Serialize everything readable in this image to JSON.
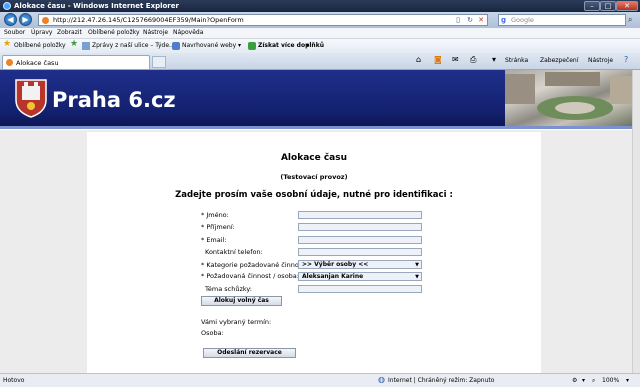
{
  "window": {
    "title": "Alokace času - Windows Internet Explorer",
    "minimize": "–",
    "maximize": "□",
    "close": "✕"
  },
  "address": {
    "url": "http://212.47.26.145/C1257669004EF359/Main?OpenForm",
    "search_placeholder": "Google"
  },
  "menu": [
    "Soubor",
    "Úpravy",
    "Zobrazit",
    "Oblíbené položky",
    "Nástroje",
    "Nápověda"
  ],
  "favorites": {
    "favorites_label": "Oblíbené položky",
    "link1": "Zprávy z naší ulice – Týde...",
    "link2": "Navrhované weby",
    "link3": "Získat více doplňků"
  },
  "tab": {
    "label": "Alokace času"
  },
  "commands": {
    "page": "Stránka",
    "security": "Zabezpečení",
    "tools": "Nástroje"
  },
  "banner": {
    "logo": "Praha 6.cz"
  },
  "form": {
    "title": "Alokace času",
    "subtitle": "(Testovací provoz)",
    "instruction": "Zadejte prosím vaše osobní údaje, nutné pro identifikaci :",
    "fields": [
      {
        "label": "* Jméno:"
      },
      {
        "label": "* Příjmení:"
      },
      {
        "label": "* Email:"
      },
      {
        "label": "Kontaktní telefon:"
      }
    ],
    "category_label": "* Kategorie požadované činnosti:",
    "category_value": ">> Výběr osoby <<",
    "activity_label": "* Požadovaná činnost / osoba:",
    "activity_value": "Aleksanjan Karine",
    "topic_label": "Téma schůzky:",
    "allocate_button": "Alokuj volný čas",
    "chosen_term_label": "Vámi vybraný termín:",
    "person_label": "Osoba:",
    "submit_button": "Odeslání rezervace"
  },
  "status": {
    "left": "Hotovo",
    "zone": "Internet | Chráněný režim: Zapnuto",
    "zoom": "100%"
  }
}
